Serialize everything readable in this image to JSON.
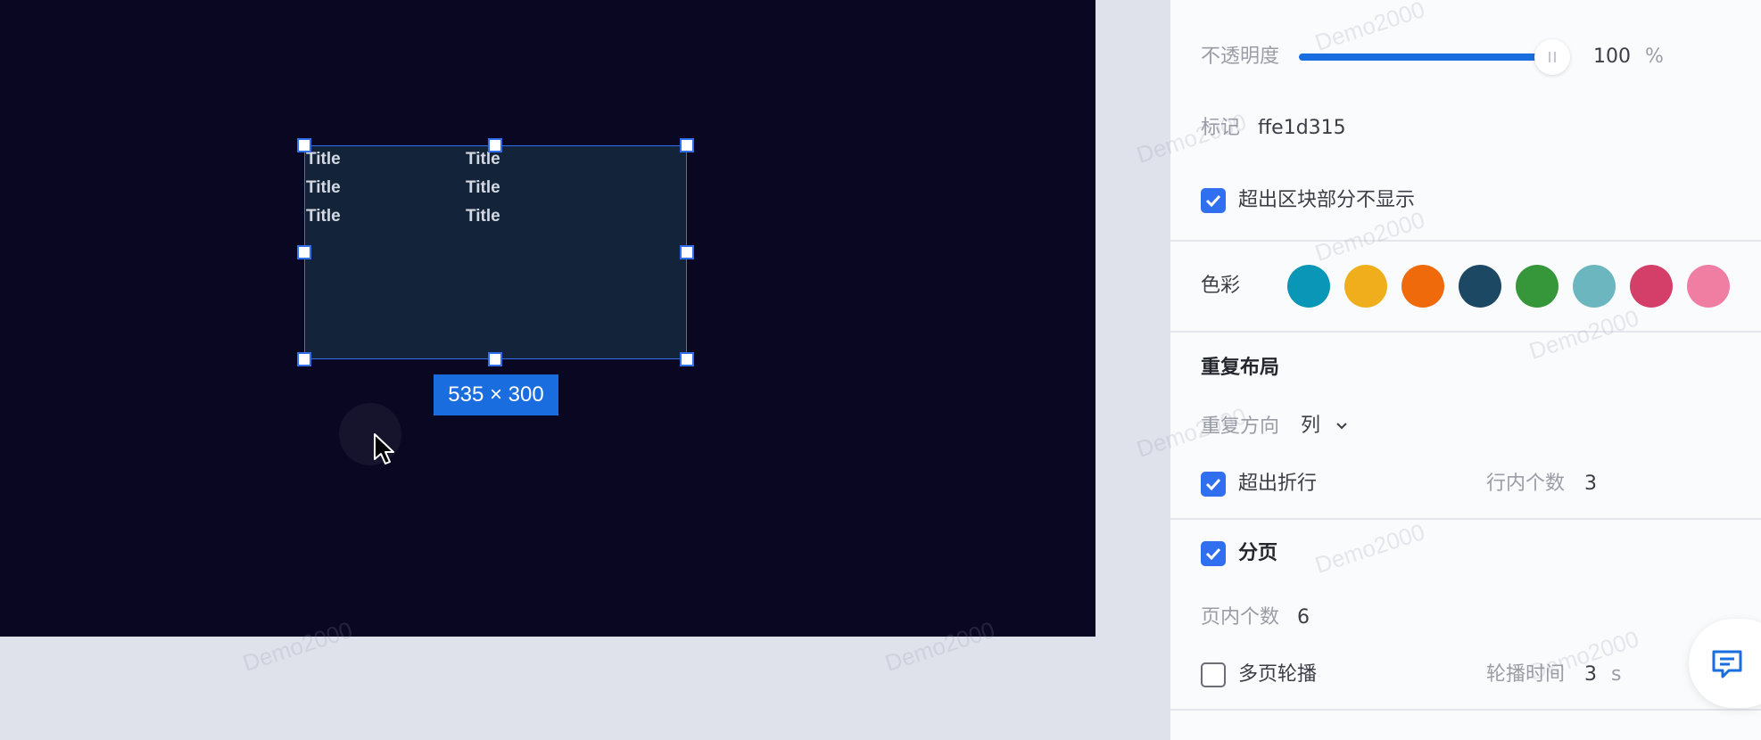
{
  "canvas": {
    "cells": [
      "Title",
      "Title",
      "Title",
      "Title",
      "Title",
      "Title"
    ],
    "size_label": "535 × 300"
  },
  "watermark": "Demo2000",
  "panel": {
    "opacity": {
      "label": "不透明度",
      "value": "100",
      "unit": "%",
      "level": 1.0
    },
    "marker": {
      "label": "标记",
      "value": "ffe1d315"
    },
    "clip": {
      "label": "超出区块部分不显示",
      "checked": true
    },
    "colors": {
      "label": "色彩",
      "swatches": [
        "#0a96b6",
        "#f0ae1c",
        "#ef6a0b",
        "#1d4863",
        "#35973a",
        "#6cb7bf",
        "#d43f69",
        "#ef7ea2"
      ]
    },
    "repeat": {
      "title": "重复布局",
      "direction_label": "重复方向",
      "direction_value": "列",
      "wrap": {
        "label": "超出折行",
        "checked": true
      },
      "per_row_label": "行内个数",
      "per_row_value": "3"
    },
    "paging": {
      "label": "分页",
      "checked": true,
      "per_page_label": "页内个数",
      "per_page_value": "6",
      "carousel": {
        "label": "多页轮播",
        "checked": false
      },
      "interval_label": "轮播时间",
      "interval_value": "3",
      "interval_unit": "s"
    }
  },
  "icons": {
    "cursor": "pointer-cursor-icon",
    "check": "check-icon",
    "chevron": "chevron-down-icon",
    "chat": "chat-message-icon"
  }
}
